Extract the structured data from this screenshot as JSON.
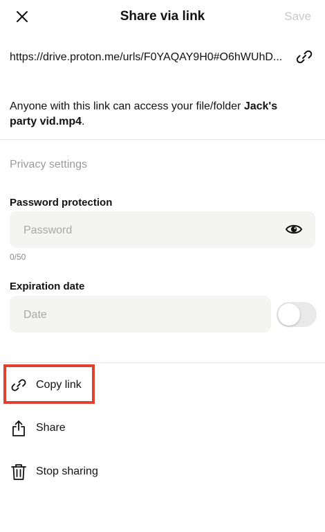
{
  "header": {
    "title": "Share via link",
    "save_label": "Save"
  },
  "link": {
    "url": "https://drive.proton.me/urls/F0YAQAY9H0#O6hWUhD..."
  },
  "description": {
    "prefix": "Anyone with this link can access your file/folder ",
    "file_name": "Jack's party vid.mp4",
    "suffix": "."
  },
  "privacy": {
    "section_label": "Privacy settings",
    "password": {
      "label": "Password protection",
      "placeholder": "Password",
      "value": "",
      "counter": "0/50"
    },
    "expiration": {
      "label": "Expiration date",
      "placeholder": "Date",
      "value": "",
      "enabled": false
    }
  },
  "actions": {
    "copy_link": "Copy link",
    "share": "Share",
    "stop_sharing": "Stop sharing"
  },
  "colors": {
    "highlight": "#e04030",
    "muted_text": "#9a9a9a",
    "field_bg": "#f4f4f3"
  },
  "icons": {
    "close": "close-icon",
    "link": "link-icon",
    "eye": "eye-icon",
    "share": "share-icon",
    "trash": "trash-icon"
  }
}
